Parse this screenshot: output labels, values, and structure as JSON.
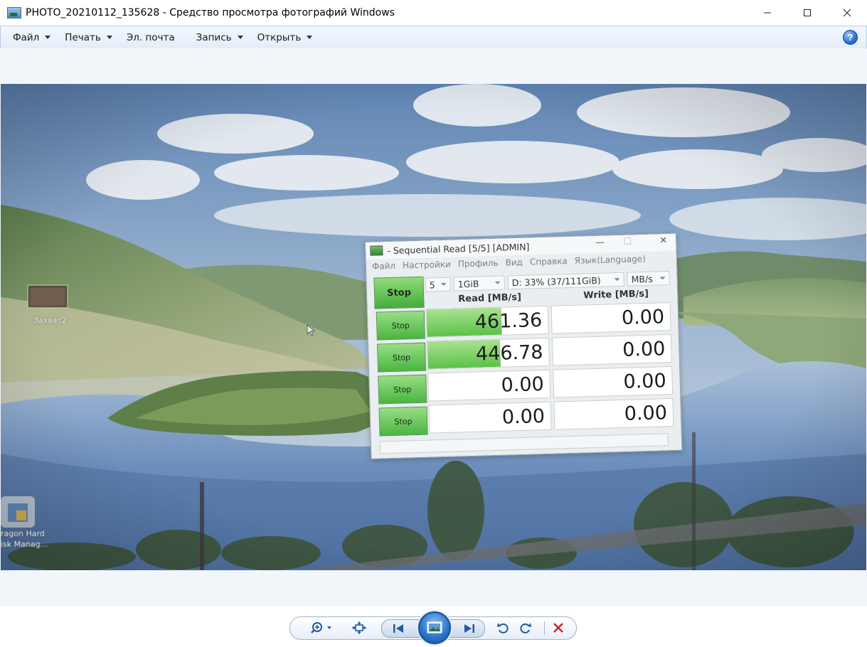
{
  "window": {
    "title": "PHOTO_20210112_135628 - Средство просмотра фотографий Windows",
    "controls": {
      "minimize": "—",
      "maximize": "☐",
      "close": "✕"
    }
  },
  "menu": {
    "items": [
      {
        "label": "Файл",
        "has_dropdown": true
      },
      {
        "label": "Печать",
        "has_dropdown": true
      },
      {
        "label": "Эл. почта",
        "has_dropdown": false
      },
      {
        "label": "Запись",
        "has_dropdown": true
      },
      {
        "label": "Открыть",
        "has_dropdown": true
      }
    ],
    "help": "?"
  },
  "photo": {
    "desktop_icons": [
      {
        "label": "Захват2"
      },
      {
        "label": "ragon Hard"
      },
      {
        "label": "isk Manag..."
      }
    ],
    "benchmark_window": {
      "title": "- Sequential Read [5/5] [ADMIN]",
      "controls": {
        "minimize": "—",
        "maximize": "☐",
        "close": "✕"
      },
      "menu": [
        "Файл",
        "Настройки",
        "Профиль",
        "Вид",
        "Справка",
        "Язык(Language)"
      ],
      "main_button": "Stop",
      "count_select": "5",
      "size_select": "1GiB",
      "drive_select": "D: 33% (37/111GiB)",
      "unit_select": "MB/s",
      "read_header": "Read [MB/s]",
      "write_header": "Write [MB/s]",
      "rows": [
        {
          "button": "Stop",
          "read": "461.36",
          "read_fill": 0.62,
          "write": "0.00",
          "write_fill": 0
        },
        {
          "button": "Stop",
          "read": "446.78",
          "read_fill": 0.6,
          "write": "0.00",
          "write_fill": 0
        },
        {
          "button": "Stop",
          "read": "0.00",
          "read_fill": 0,
          "write": "0.00",
          "write_fill": 0
        },
        {
          "button": "Stop",
          "read": "0.00",
          "read_fill": 0,
          "write": "0.00",
          "write_fill": 0
        }
      ]
    }
  },
  "toolbar": {
    "buttons": [
      {
        "icon": "zoom-icon"
      },
      {
        "icon": "fit-to-window-icon"
      },
      {
        "icon": "previous-icon"
      },
      {
        "icon": "slideshow-icon"
      },
      {
        "icon": "next-icon"
      },
      {
        "icon": "rotate-left-icon"
      },
      {
        "icon": "rotate-right-icon"
      },
      {
        "icon": "delete-icon"
      }
    ]
  }
}
